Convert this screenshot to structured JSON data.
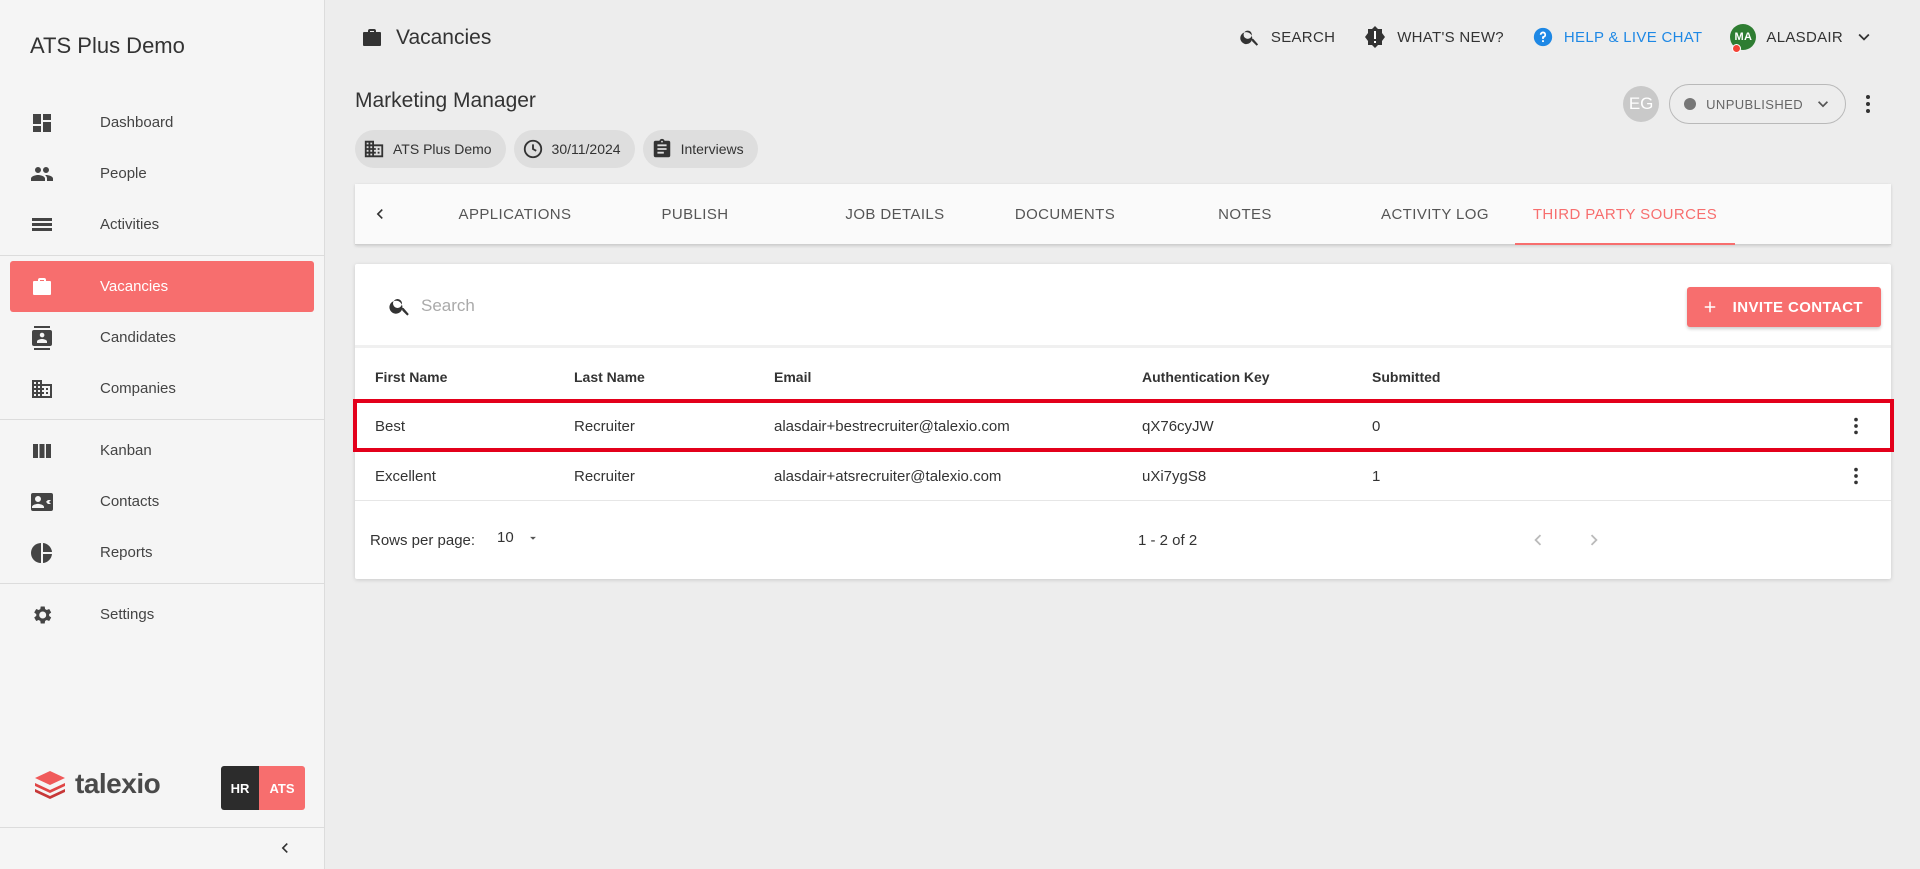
{
  "sidebar": {
    "app_title": "ATS Plus Demo",
    "groups": [
      [
        {
          "label": "Dashboard",
          "icon": "dashboard-icon",
          "active": false
        },
        {
          "label": "People",
          "icon": "people-icon",
          "active": false
        },
        {
          "label": "Activities",
          "icon": "activities-icon",
          "active": false
        }
      ],
      [
        {
          "label": "Vacancies",
          "icon": "briefcase-icon",
          "active": true
        },
        {
          "label": "Candidates",
          "icon": "candidate-card-icon",
          "active": false
        },
        {
          "label": "Companies",
          "icon": "building-icon",
          "active": false
        }
      ],
      [
        {
          "label": "Kanban",
          "icon": "kanban-icon",
          "active": false
        },
        {
          "label": "Contacts",
          "icon": "contact-card-icon",
          "active": false
        },
        {
          "label": "Reports",
          "icon": "pie-chart-icon",
          "active": false
        }
      ],
      [
        {
          "label": "Settings",
          "icon": "gear-icon",
          "active": false
        }
      ]
    ],
    "brand": "talexio",
    "badge_hr": "HR",
    "badge_ats": "ATS"
  },
  "topbar": {
    "section_title": "Vacancies",
    "search_label": "SEARCH",
    "whats_new_label": "WHAT'S NEW?",
    "help_label": "HELP & LIVE CHAT",
    "user_initials": "MA",
    "user_name": "ALASDAIR"
  },
  "job": {
    "title": "Marketing Manager",
    "company": "ATS Plus Demo",
    "date": "30/11/2024",
    "stage": "Interviews",
    "owner_initials": "EG",
    "status": "UNPUBLISHED"
  },
  "tabs": [
    {
      "label": "APPLICATIONS",
      "active": false
    },
    {
      "label": "PUBLISH",
      "active": false
    },
    {
      "label": "JOB DETAILS",
      "active": false
    },
    {
      "label": "DOCUMENTS",
      "active": false
    },
    {
      "label": "NOTES",
      "active": false
    },
    {
      "label": "ACTIVITY LOG",
      "active": false
    },
    {
      "label": "THIRD PARTY SOURCES",
      "active": true
    }
  ],
  "table": {
    "search_placeholder": "Search",
    "invite_label": "INVITE CONTACT",
    "columns": [
      "First Name",
      "Last Name",
      "Email",
      "Authentication Key",
      "Submitted"
    ],
    "rows": [
      {
        "first": "Best",
        "last": "Recruiter",
        "email": "alasdair+bestrecruiter@talexio.com",
        "key": "qX76cyJW",
        "submitted": "0",
        "highlighted": true
      },
      {
        "first": "Excellent",
        "last": "Recruiter",
        "email": "alasdair+atsrecruiter@talexio.com",
        "key": "uXi7ygS8",
        "submitted": "1",
        "highlighted": false
      }
    ],
    "rows_per_page_label": "Rows per page:",
    "rows_per_page": "10",
    "page_info": "1 - 2 of 2"
  },
  "colors": {
    "accent": "#f76e6e",
    "help": "#1e88e5",
    "highlight": "#e3001b"
  }
}
